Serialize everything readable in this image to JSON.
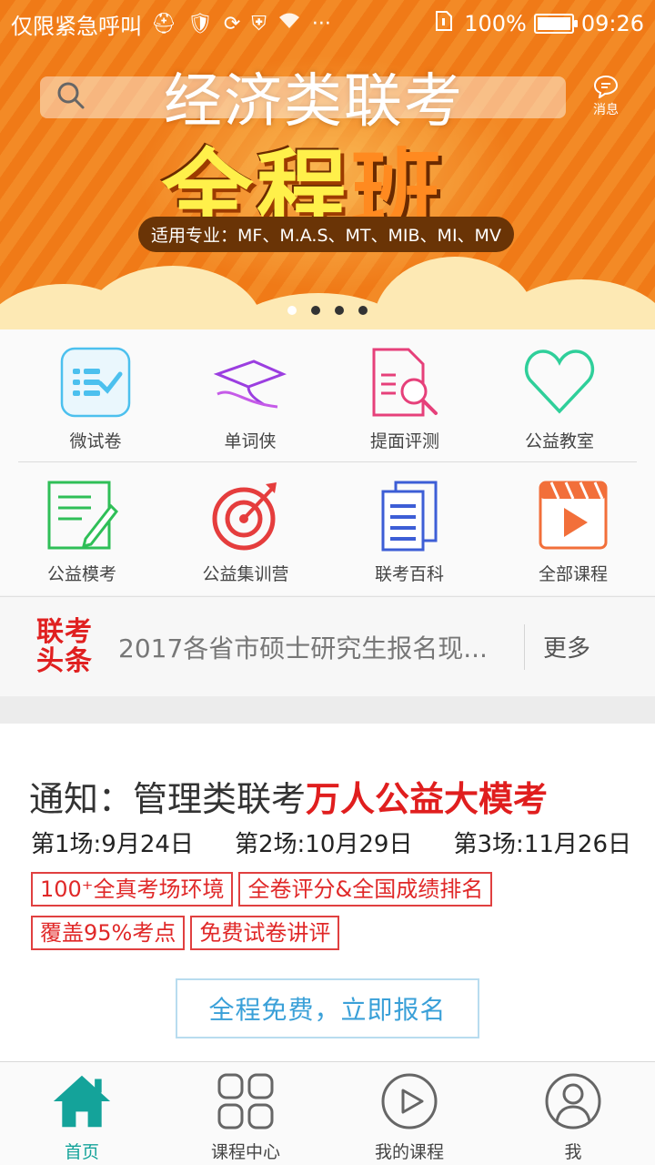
{
  "status_bar": {
    "carrier": "仅限紧急呼叫",
    "battery": "100%",
    "time": "09:26"
  },
  "banner": {
    "search_placeholder": "",
    "message_label": "消息",
    "title_line1": "经济类联考",
    "title_line2_a": "全程",
    "title_line2_b": "班",
    "subtitle": "适用专业：MF、M.A.S、MT、MIB、MI、MV",
    "active_slide": 0,
    "slide_count": 4
  },
  "grid": {
    "row1": [
      {
        "label": "微试卷",
        "icon": "exam-check-icon"
      },
      {
        "label": "单词侠",
        "icon": "graduation-cap-icon"
      },
      {
        "label": "提面评测",
        "icon": "document-search-icon"
      },
      {
        "label": "公益教室",
        "icon": "heart-icon"
      }
    ],
    "row2": [
      {
        "label": "公益模考",
        "icon": "notepad-pencil-icon"
      },
      {
        "label": "公益集训营",
        "icon": "target-icon"
      },
      {
        "label": "联考百科",
        "icon": "book-list-icon"
      },
      {
        "label": "全部课程",
        "icon": "video-play-icon"
      }
    ]
  },
  "news": {
    "logo_line1": "联考",
    "logo_line2": "头条",
    "headline": "2017各省市硕士研究生报名现...",
    "more": "更多"
  },
  "notice": {
    "title_prefix": "通知：管理类联考",
    "title_highlight": "万人公益大模考",
    "sessions": [
      "第1场:9月24日",
      "第2场:10月29日",
      "第3场:11月26日"
    ],
    "tags": [
      "100⁺全真考场环境",
      "全卷评分&全国成绩排名",
      "覆盖95%考点",
      "免费试卷讲评"
    ],
    "signup_button": "全程免费，立即报名"
  },
  "tabbar": {
    "items": [
      {
        "label": "首页",
        "icon": "home-icon",
        "active": true
      },
      {
        "label": "课程中心",
        "icon": "grid-icon",
        "active": false
      },
      {
        "label": "我的课程",
        "icon": "play-circle-icon",
        "active": false
      },
      {
        "label": "我",
        "icon": "user-icon",
        "active": false
      }
    ]
  },
  "colors": {
    "banner_orange": "#f07a17",
    "accent_red": "#e01e1e",
    "tab_active": "#14a39a",
    "signup_blue": "#3aa0d8"
  }
}
